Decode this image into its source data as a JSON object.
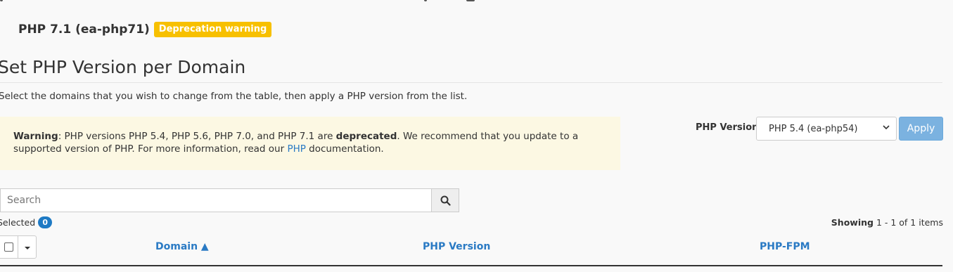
{
  "php_header": {
    "name": "PHP 7.1 (ea-php71)",
    "badge": "Deprecation warning",
    "badge_color": "#f7c000"
  },
  "section": {
    "title": "Set PHP Version per Domain",
    "instructions": "Select the domains that you wish to change from the table, then apply a PHP version from the list."
  },
  "warning": {
    "label": "Warning",
    "text_1": ": PHP versions PHP 5.4, PHP 5.6, PHP 7.0, and PHP 7.1 are ",
    "emphasis": "deprecated",
    "text_2": ". We recommend that you update to a supported version of PHP. For more information, read our ",
    "link": "PHP",
    "text_3": " documentation.",
    "bg_color": "#fcf8e3"
  },
  "version_control": {
    "label": "PHP Version",
    "selected": "PHP 5.4 (ea-php54)",
    "apply_label": "Apply",
    "apply_color": "#7bb2e0"
  },
  "search": {
    "placeholder": "Search",
    "icon": "search-icon"
  },
  "selection": {
    "label": "Selected",
    "count": "0"
  },
  "pagination": {
    "showing_label": "Showing",
    "range": "1 - 1 of 1 items"
  },
  "table": {
    "columns": [
      {
        "label": "Domain",
        "sort": "▲"
      },
      {
        "label": "PHP Version"
      },
      {
        "label": "PHP-FPM"
      }
    ],
    "link_color": "#2a7ac4"
  }
}
